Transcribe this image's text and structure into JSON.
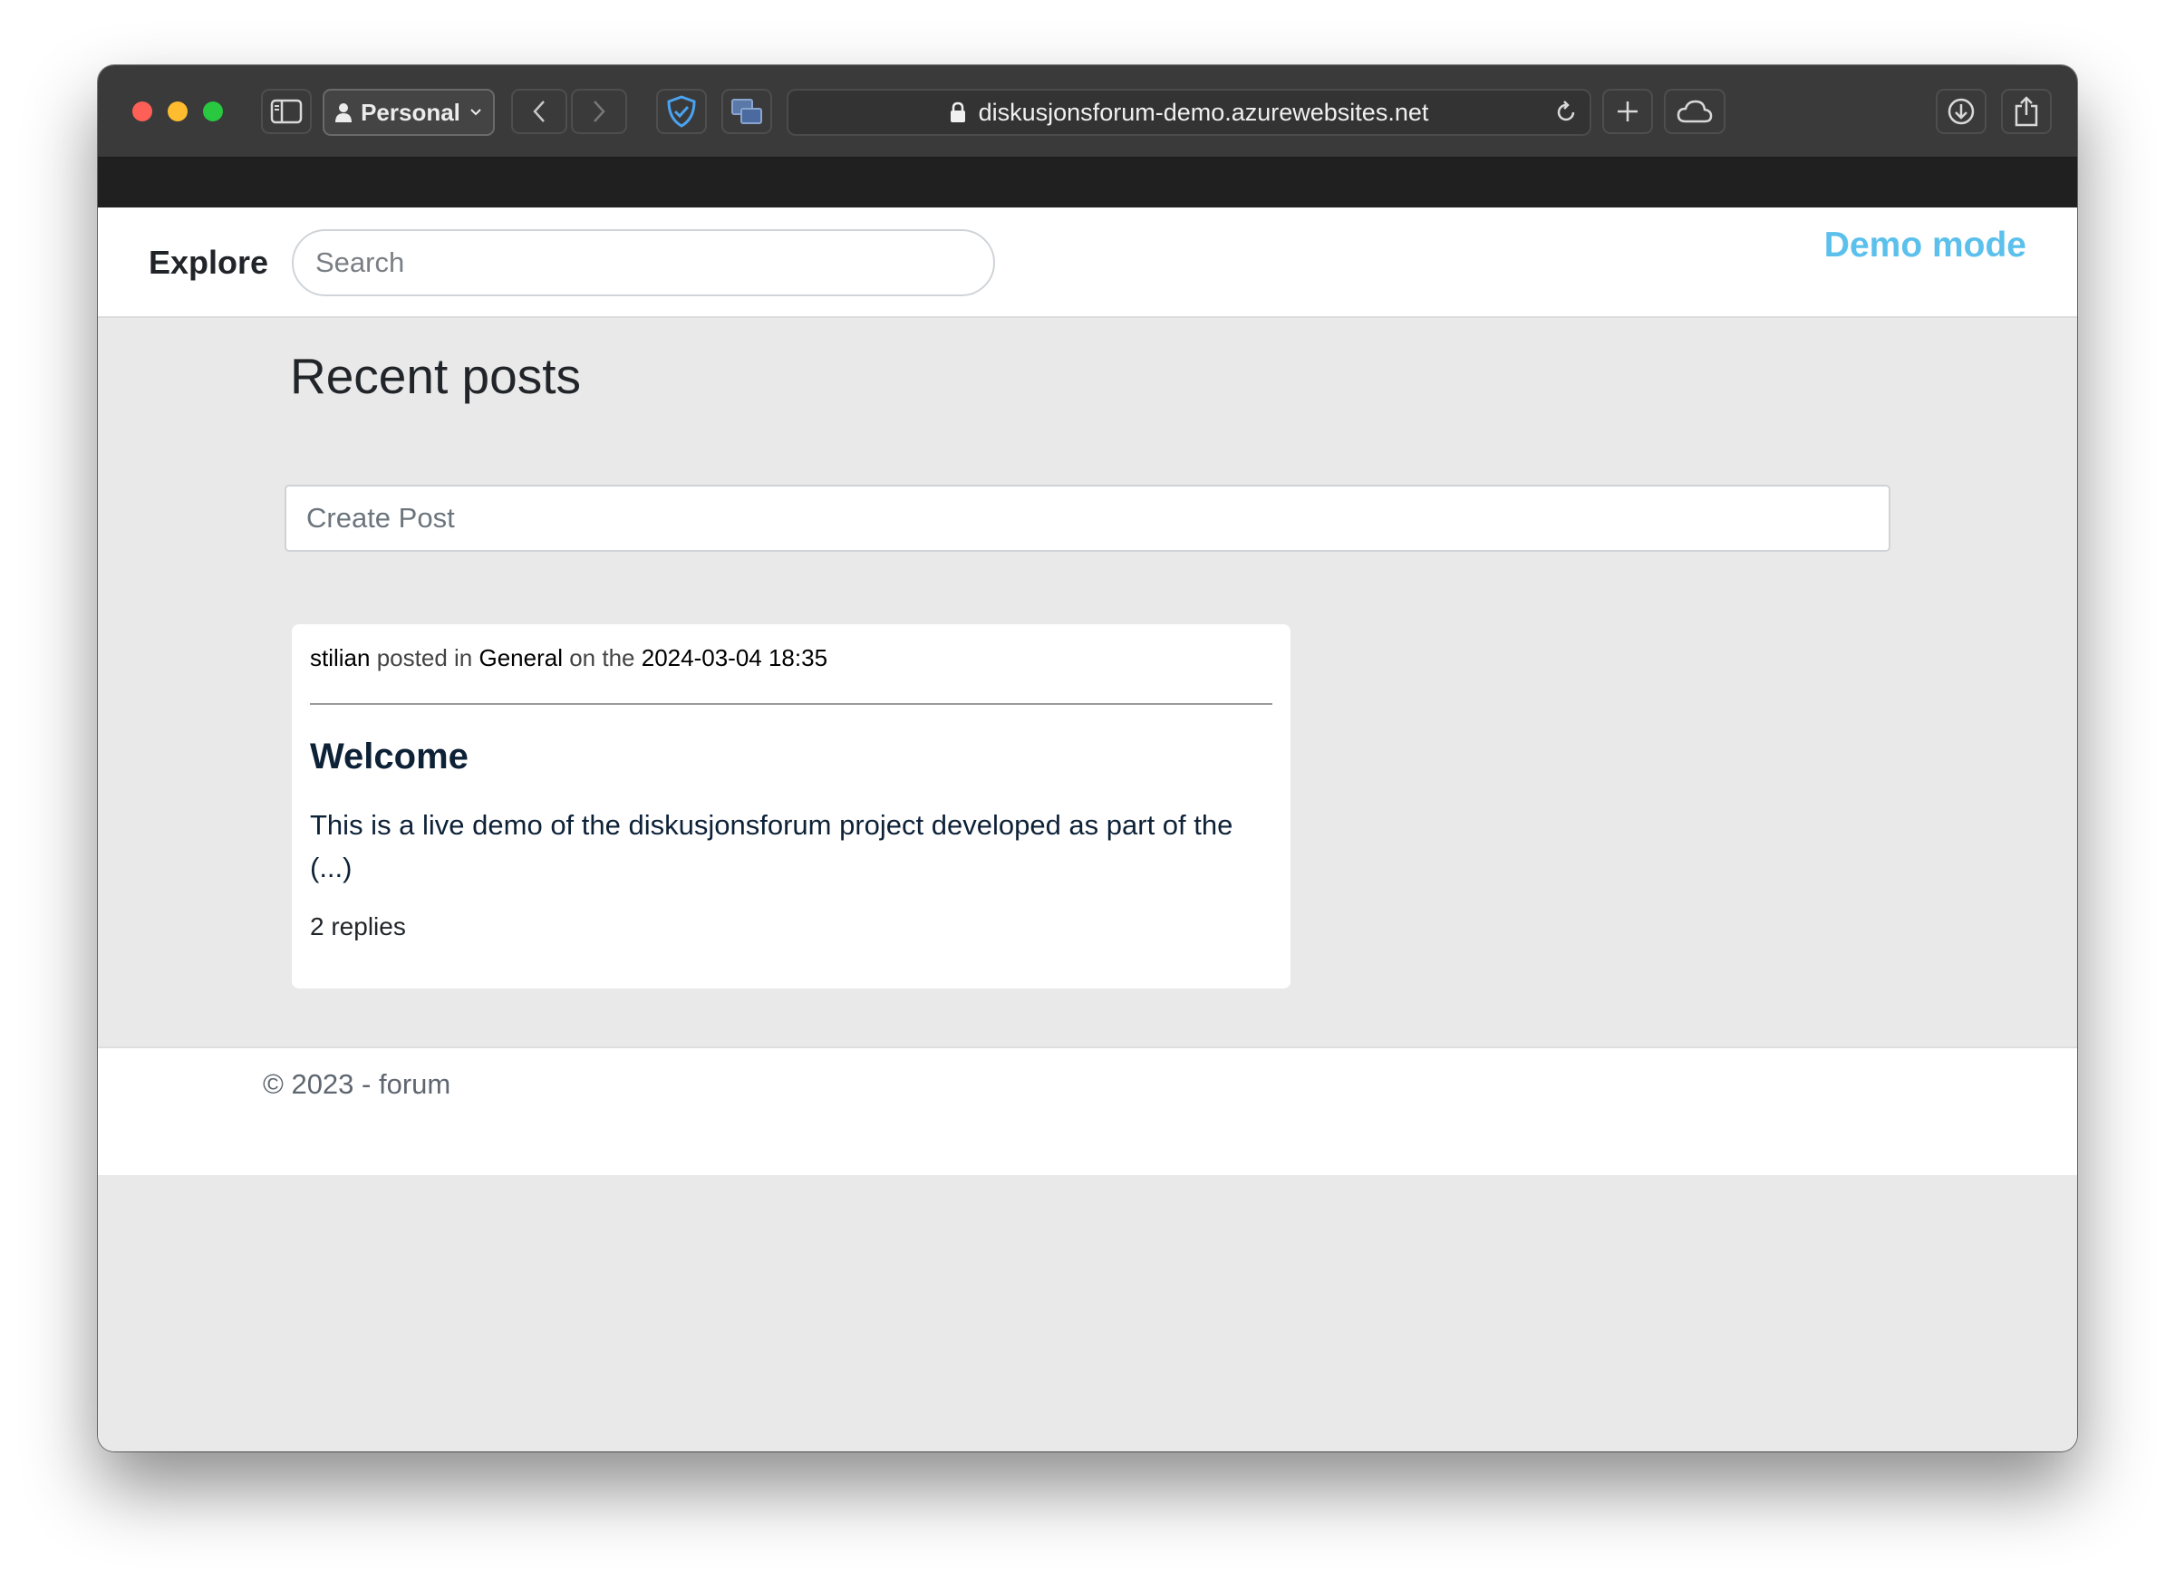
{
  "browser": {
    "profile_label": "Personal",
    "url": "diskusjonsforum-demo.azurewebsites.net",
    "icons": [
      "sidebar-icon",
      "person-icon",
      "chevron-down-icon",
      "back-icon",
      "forward-icon",
      "shield-icon",
      "windows-icon",
      "lock-icon",
      "reload-icon",
      "plus-icon",
      "cloud-icon",
      "download-icon",
      "share-icon"
    ]
  },
  "navbar": {
    "brand": "Explore",
    "search_placeholder": "Search",
    "demo_label": "Demo mode",
    "demo_color": "#5bc0eb"
  },
  "main": {
    "title": "Recent posts",
    "create_post_placeholder": "Create Post",
    "posts": [
      {
        "author": "stilian",
        "posted_in_text": "posted in",
        "category": "General",
        "on_the_text": "on the",
        "date": "2024-03-04 18:35",
        "title": "Welcome",
        "excerpt": "This is a live demo of the diskusjonsforum project developed as part of the (...)",
        "replies": "2 replies"
      }
    ]
  },
  "footer": {
    "text": "© 2023 - forum"
  }
}
